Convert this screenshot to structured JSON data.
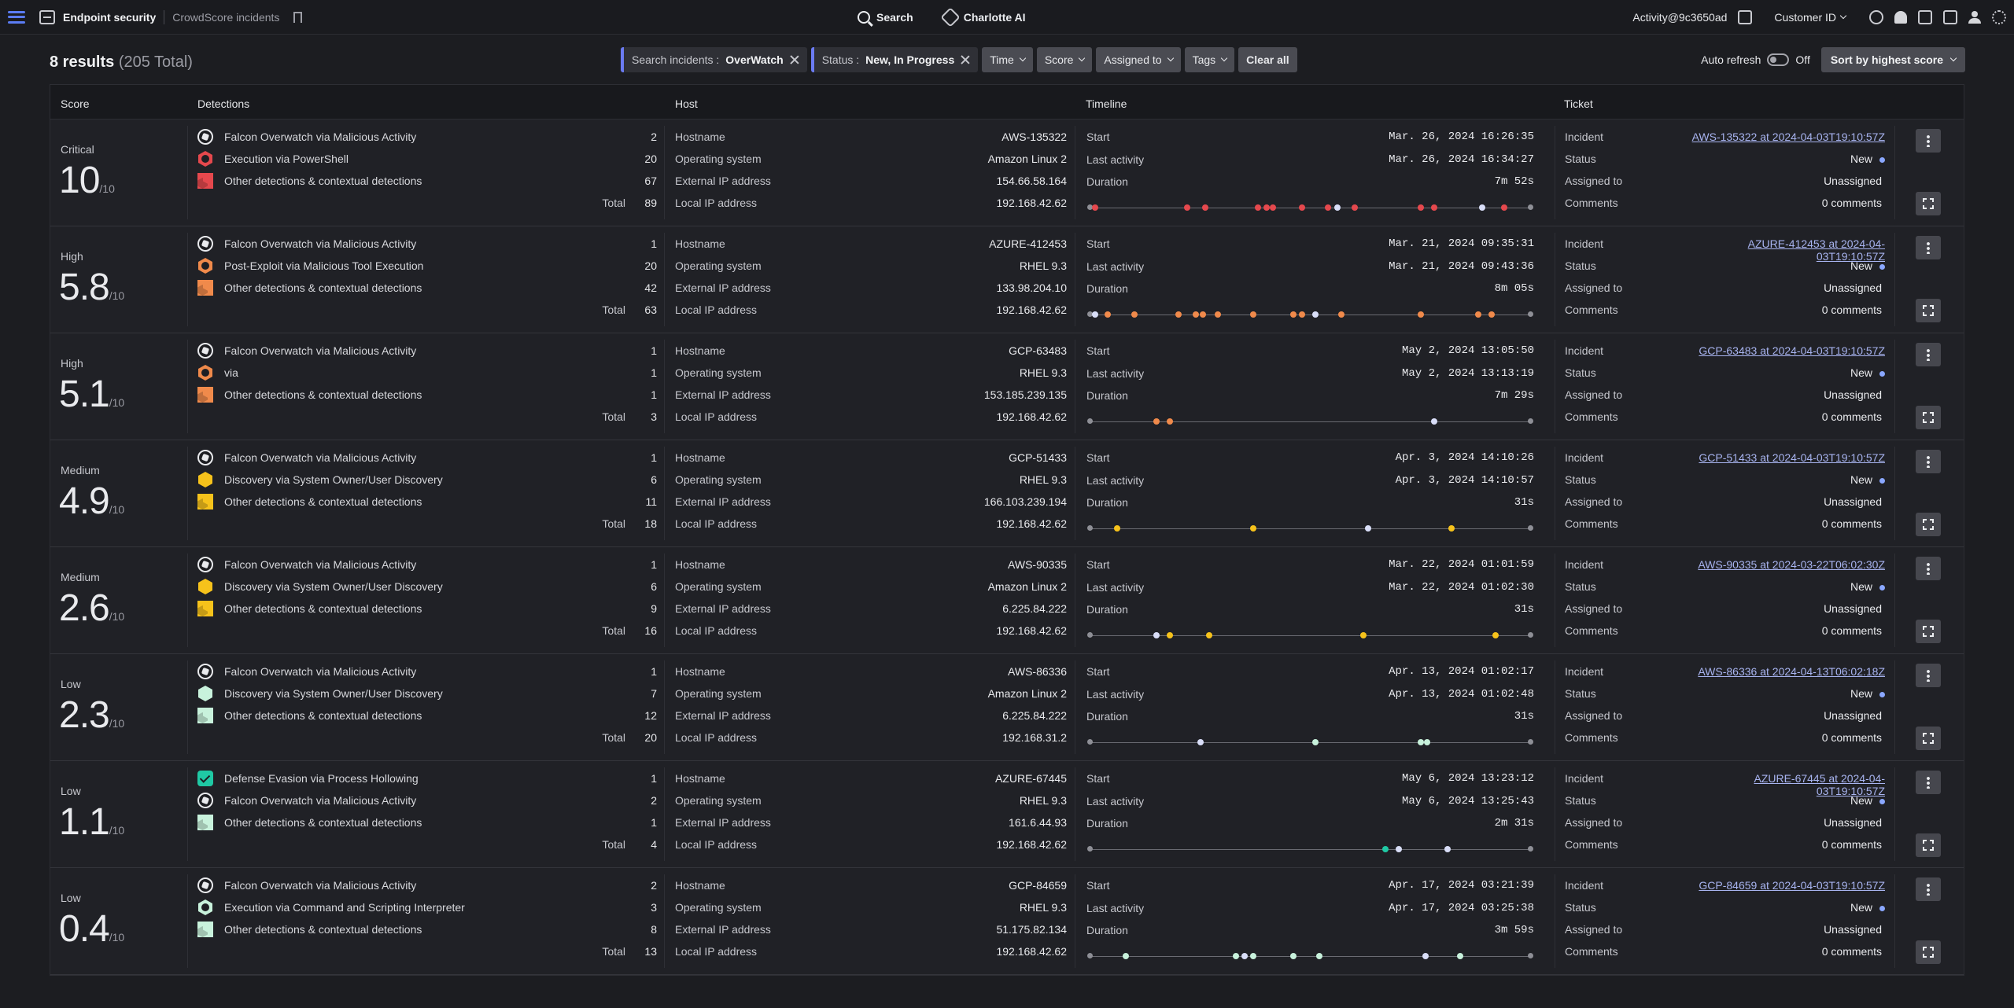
{
  "topbar": {
    "title": "Endpoint security",
    "subtitle": "CrowdScore incidents",
    "search": "Search",
    "ai": "Charlotte AI",
    "activity": "Activity@9c3650ad",
    "customer": "Customer ID"
  },
  "toolbar": {
    "results_count": "8 results",
    "results_total": "(205 Total)",
    "filter_search_label": "Search incidents :",
    "filter_search_value": "OverWatch",
    "filter_status_label": "Status :",
    "filter_status_value": "New, In Progress",
    "time": "Time",
    "score": "Score",
    "assigned": "Assigned to",
    "tags": "Tags",
    "clear": "Clear all",
    "auto_refresh": "Auto refresh",
    "auto_refresh_state": "Off",
    "sort": "Sort by highest score"
  },
  "columns": [
    "Score",
    "Detections",
    "Host",
    "Timeline",
    "Ticket"
  ],
  "labels": {
    "total": "Total",
    "hostname": "Hostname",
    "os": "Operating system",
    "ext_ip": "External IP address",
    "local_ip": "Local IP address",
    "start": "Start",
    "last": "Last activity",
    "duration": "Duration",
    "incident": "Incident",
    "status": "Status",
    "assigned": "Assigned to",
    "comments": "Comments",
    "score_denom": "/10"
  },
  "colors": {
    "critical": "#e5484d",
    "high": "#f08a4b",
    "medium": "#f6c21b",
    "low": "#c8f2dc",
    "white": "#d9def8",
    "teal": "#1fc9a4"
  },
  "incidents": [
    {
      "severity": "Critical",
      "score": "10",
      "detections": [
        {
          "icon": "overwatch",
          "color": "white",
          "name": "Falcon Overwatch via Malicious Activity",
          "count": "2"
        },
        {
          "icon": "hex",
          "color": "critical",
          "name": "Execution via PowerShell",
          "count": "20"
        },
        {
          "icon": "stack",
          "color": "critical",
          "name": "Other detections & contextual detections",
          "count": "67"
        }
      ],
      "total": "89",
      "host": {
        "hostname": "AWS-135322",
        "os": "Amazon Linux 2",
        "ext_ip": "154.66.58.164",
        "local_ip": "192.168.42.62"
      },
      "timeline": {
        "start": "Mar. 26, 2024 16:26:35",
        "last": "Mar. 26, 2024 16:34:27",
        "duration": "7m 52s",
        "dots": [
          [
            0.01,
            "critical"
          ],
          [
            0.22,
            "critical"
          ],
          [
            0.26,
            "critical"
          ],
          [
            0.38,
            "critical"
          ],
          [
            0.4,
            "critical"
          ],
          [
            0.415,
            "critical"
          ],
          [
            0.48,
            "critical"
          ],
          [
            0.54,
            "critical"
          ],
          [
            0.56,
            "white"
          ],
          [
            0.6,
            "critical"
          ],
          [
            0.75,
            "critical"
          ],
          [
            0.78,
            "critical"
          ],
          [
            0.89,
            "white"
          ],
          [
            0.94,
            "critical"
          ]
        ]
      },
      "ticket": {
        "incident": "AWS-135322 at 2024-04-03T19:10:57Z",
        "status": "New",
        "assigned": "Unassigned",
        "comments": "0 comments"
      }
    },
    {
      "severity": "High",
      "score": "5.8",
      "detections": [
        {
          "icon": "overwatch",
          "color": "white",
          "name": "Falcon Overwatch via Malicious Activity",
          "count": "1"
        },
        {
          "icon": "hex",
          "color": "high",
          "name": "Post-Exploit via Malicious Tool Execution",
          "count": "20"
        },
        {
          "icon": "stack",
          "color": "high",
          "name": "Other detections & contextual detections",
          "count": "42"
        }
      ],
      "total": "63",
      "host": {
        "hostname": "AZURE-412453",
        "os": "RHEL 9.3",
        "ext_ip": "133.98.204.10",
        "local_ip": "192.168.42.62"
      },
      "timeline": {
        "start": "Mar. 21, 2024 09:35:31",
        "last": "Mar. 21, 2024 09:43:36",
        "duration": "8m 05s",
        "dots": [
          [
            0.01,
            "white"
          ],
          [
            0.04,
            "high"
          ],
          [
            0.1,
            "high"
          ],
          [
            0.2,
            "high"
          ],
          [
            0.24,
            "high"
          ],
          [
            0.255,
            "high"
          ],
          [
            0.29,
            "high"
          ],
          [
            0.37,
            "high"
          ],
          [
            0.46,
            "high"
          ],
          [
            0.48,
            "high"
          ],
          [
            0.51,
            "white"
          ],
          [
            0.57,
            "high"
          ],
          [
            0.75,
            "high"
          ],
          [
            0.88,
            "high"
          ],
          [
            0.91,
            "high"
          ]
        ]
      },
      "ticket": {
        "incident": "AZURE-412453 at 2024-04-03T19:10:57Z",
        "status": "New",
        "assigned": "Unassigned",
        "comments": "0 comments"
      }
    },
    {
      "severity": "High",
      "score": "5.1",
      "detections": [
        {
          "icon": "overwatch",
          "color": "white",
          "name": "Falcon Overwatch via Malicious Activity",
          "count": "1"
        },
        {
          "icon": "hex",
          "color": "high",
          "name": "via",
          "count": "1"
        },
        {
          "icon": "stack",
          "color": "high",
          "name": "Other detections & contextual detections",
          "count": "1"
        }
      ],
      "total": "3",
      "host": {
        "hostname": "GCP-63483",
        "os": "RHEL 9.3",
        "ext_ip": "153.185.239.135",
        "local_ip": "192.168.42.62"
      },
      "timeline": {
        "start": "May 2, 2024 13:05:50",
        "last": "May 2, 2024 13:13:19",
        "duration": "7m 29s",
        "dots": [
          [
            0.15,
            "high"
          ],
          [
            0.18,
            "high"
          ],
          [
            0.78,
            "white"
          ]
        ]
      },
      "ticket": {
        "incident": "GCP-63483 at 2024-04-03T19:10:57Z",
        "status": "New",
        "assigned": "Unassigned",
        "comments": "0 comments"
      }
    },
    {
      "severity": "Medium",
      "score": "4.9",
      "detections": [
        {
          "icon": "overwatch",
          "color": "white",
          "name": "Falcon Overwatch via Malicious Activity",
          "count": "1"
        },
        {
          "icon": "hexsolid",
          "color": "medium",
          "name": "Discovery via System Owner/User Discovery",
          "count": "6"
        },
        {
          "icon": "stack",
          "color": "medium",
          "name": "Other detections & contextual detections",
          "count": "11"
        }
      ],
      "total": "18",
      "host": {
        "hostname": "GCP-51433",
        "os": "RHEL 9.3",
        "ext_ip": "166.103.239.194",
        "local_ip": "192.168.42.62"
      },
      "timeline": {
        "start": "Apr. 3, 2024 14:10:26",
        "last": "Apr. 3, 2024 14:10:57",
        "duration": "31s",
        "dots": [
          [
            0.06,
            "medium"
          ],
          [
            0.37,
            "medium"
          ],
          [
            0.63,
            "white"
          ],
          [
            0.82,
            "medium"
          ]
        ]
      },
      "ticket": {
        "incident": "GCP-51433 at 2024-04-03T19:10:57Z",
        "status": "New",
        "assigned": "Unassigned",
        "comments": "0 comments"
      }
    },
    {
      "severity": "Medium",
      "score": "2.6",
      "detections": [
        {
          "icon": "overwatch",
          "color": "white",
          "name": "Falcon Overwatch via Malicious Activity",
          "count": "1"
        },
        {
          "icon": "hexsolid",
          "color": "medium",
          "name": "Discovery via System Owner/User Discovery",
          "count": "6"
        },
        {
          "icon": "stack",
          "color": "medium",
          "name": "Other detections & contextual detections",
          "count": "9"
        }
      ],
      "total": "16",
      "host": {
        "hostname": "AWS-90335",
        "os": "Amazon Linux 2",
        "ext_ip": "6.225.84.222",
        "local_ip": "192.168.42.62"
      },
      "timeline": {
        "start": "Mar. 22, 2024 01:01:59",
        "last": "Mar. 22, 2024 01:02:30",
        "duration": "31s",
        "dots": [
          [
            0.15,
            "white"
          ],
          [
            0.18,
            "medium"
          ],
          [
            0.27,
            "medium"
          ],
          [
            0.62,
            "medium"
          ],
          [
            0.92,
            "medium"
          ]
        ]
      },
      "ticket": {
        "incident": "AWS-90335 at 2024-03-22T06:02:30Z",
        "status": "New",
        "assigned": "Unassigned",
        "comments": "0 comments"
      }
    },
    {
      "severity": "Low",
      "score": "2.3",
      "detections": [
        {
          "icon": "overwatch",
          "color": "white",
          "name": "Falcon Overwatch via Malicious Activity",
          "count": "1"
        },
        {
          "icon": "hexsolid",
          "color": "low",
          "name": "Discovery via System Owner/User Discovery",
          "count": "7"
        },
        {
          "icon": "stack",
          "color": "low",
          "name": "Other detections & contextual detections",
          "count": "12"
        }
      ],
      "total": "20",
      "host": {
        "hostname": "AWS-86336",
        "os": "Amazon Linux 2",
        "ext_ip": "6.225.84.222",
        "local_ip": "192.168.31.2"
      },
      "timeline": {
        "start": "Apr. 13, 2024 01:02:17",
        "last": "Apr. 13, 2024 01:02:48",
        "duration": "31s",
        "dots": [
          [
            0.25,
            "white"
          ],
          [
            0.51,
            "low"
          ],
          [
            0.75,
            "low"
          ],
          [
            0.765,
            "low"
          ]
        ]
      },
      "ticket": {
        "incident": "AWS-86336 at 2024-04-13T06:02:18Z",
        "status": "New",
        "assigned": "Unassigned",
        "comments": "0 comments"
      }
    },
    {
      "severity": "Low",
      "score": "1.1",
      "detections": [
        {
          "icon": "check",
          "color": "teal",
          "name": "Defense Evasion via Process Hollowing",
          "count": "1"
        },
        {
          "icon": "overwatch",
          "color": "white",
          "name": "Falcon Overwatch via Malicious Activity",
          "count": "2"
        },
        {
          "icon": "stack",
          "color": "low",
          "name": "Other detections & contextual detections",
          "count": "1"
        }
      ],
      "total": "4",
      "host": {
        "hostname": "AZURE-67445",
        "os": "RHEL 9.3",
        "ext_ip": "161.6.44.93",
        "local_ip": "192.168.42.62"
      },
      "timeline": {
        "start": "May 6, 2024 13:23:12",
        "last": "May 6, 2024 13:25:43",
        "duration": "2m 31s",
        "dots": [
          [
            0.67,
            "teal"
          ],
          [
            0.7,
            "white"
          ],
          [
            0.81,
            "white"
          ]
        ]
      },
      "ticket": {
        "incident": "AZURE-67445 at 2024-04-03T19:10:57Z",
        "status": "New",
        "assigned": "Unassigned",
        "comments": "0 comments"
      }
    },
    {
      "severity": "Low",
      "score": "0.4",
      "detections": [
        {
          "icon": "overwatch",
          "color": "white",
          "name": "Falcon Overwatch via Malicious Activity",
          "count": "2"
        },
        {
          "icon": "hex",
          "color": "low",
          "name": "Execution via Command and Scripting Interpreter",
          "count": "3"
        },
        {
          "icon": "stack",
          "color": "low",
          "name": "Other detections & contextual detections",
          "count": "8"
        }
      ],
      "total": "13",
      "host": {
        "hostname": "GCP-84659",
        "os": "RHEL 9.3",
        "ext_ip": "51.175.82.134",
        "local_ip": "192.168.42.62"
      },
      "timeline": {
        "start": "Apr. 17, 2024 03:21:39",
        "last": "Apr. 17, 2024 03:25:38",
        "duration": "3m 59s",
        "dots": [
          [
            0.08,
            "low"
          ],
          [
            0.33,
            "low"
          ],
          [
            0.35,
            "white"
          ],
          [
            0.37,
            "low"
          ],
          [
            0.46,
            "low"
          ],
          [
            0.52,
            "low"
          ],
          [
            0.76,
            "white"
          ],
          [
            0.84,
            "low"
          ]
        ]
      },
      "ticket": {
        "incident": "GCP-84659 at 2024-04-03T19:10:57Z",
        "status": "New",
        "assigned": "Unassigned",
        "comments": "0 comments"
      }
    }
  ]
}
